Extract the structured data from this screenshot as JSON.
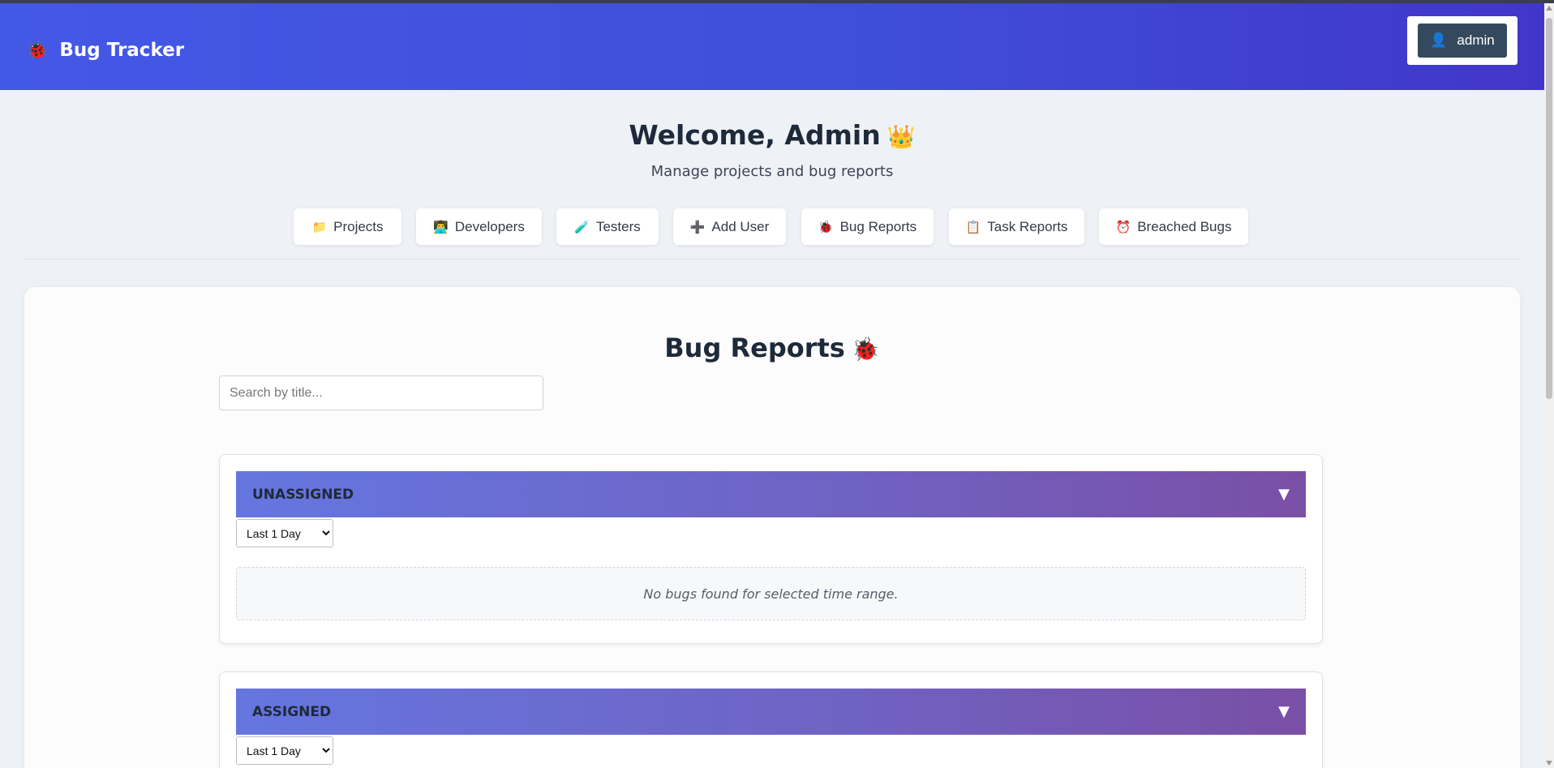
{
  "app": {
    "title": "Bug Tracker",
    "logo_icon": "ladybug-icon"
  },
  "user": {
    "name": "admin",
    "icon": "user-silhouette-icon"
  },
  "welcome": {
    "title": "Welcome, Admin",
    "subtitle": "Manage projects and bug reports"
  },
  "nav": [
    {
      "label": "Projects",
      "icon": "folder-icon",
      "glyph": "📁"
    },
    {
      "label": "Developers",
      "icon": "developer-icon",
      "glyph": "👨‍💻"
    },
    {
      "label": "Testers",
      "icon": "test-tube-icon",
      "glyph": "🧪"
    },
    {
      "label": "Add User",
      "icon": "plus-icon",
      "glyph": "➕"
    },
    {
      "label": "Bug Reports",
      "icon": "bug-icon",
      "glyph": "🐞"
    },
    {
      "label": "Task Reports",
      "icon": "clipboard-icon",
      "glyph": "📋"
    },
    {
      "label": "Breached Bugs",
      "icon": "alarm-clock-icon",
      "glyph": "⏰"
    }
  ],
  "bug_reports": {
    "title": "Bug Reports",
    "search_placeholder": "Search by title...",
    "groups": [
      {
        "title": "UNASSIGNED",
        "range": "Last 1 Day",
        "empty_text": "No bugs found for selected time range."
      },
      {
        "title": "ASSIGNED",
        "range": "Last 1 Day"
      }
    ],
    "range_options": [
      "Last 1 Day"
    ]
  },
  "colors": {
    "header_start": "#4458e6",
    "header_end": "#4136c9",
    "group_header_start": "#6576e0",
    "group_header_end": "#7a4fa6",
    "user_button": "#34495e"
  }
}
